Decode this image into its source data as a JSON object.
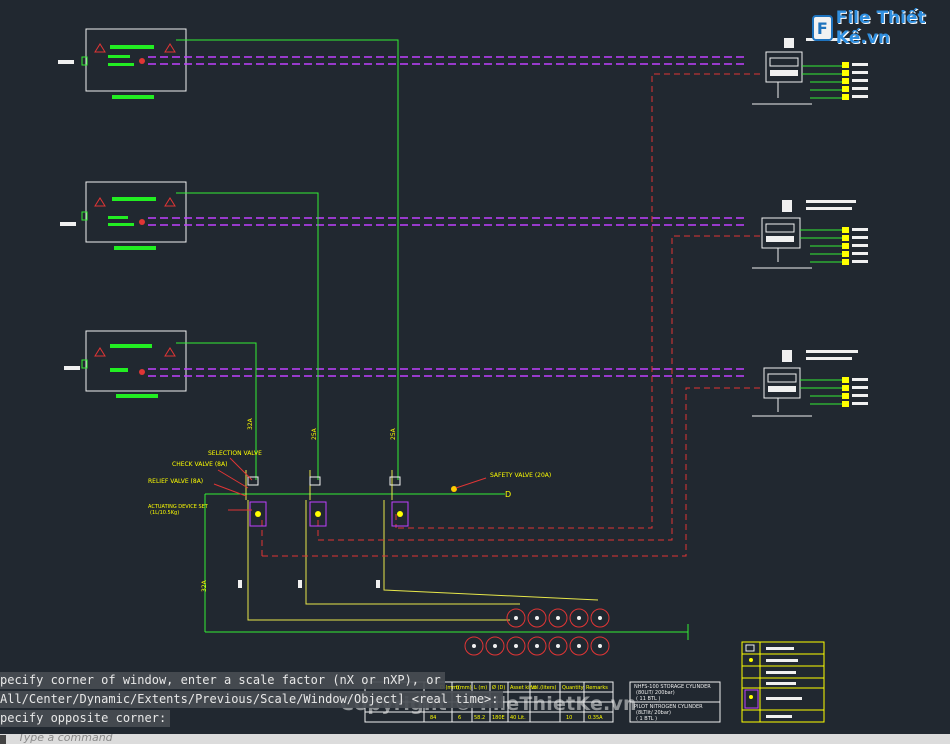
{
  "drawing": {
    "labels": {
      "selection_valve": "SELECTION VALVE",
      "check_valve": "CHECK VALVE (8A)",
      "relief_valve": "RELIEF VALVE (8A)",
      "actuating_device": "ACTUATING DEVICE SET",
      "actuating_device_sub": "(1L/10.5Kg)",
      "safety_valve": "SAFETY VALVE (20A)",
      "pipe_size_1": "32A",
      "pipe_size_2": "25A",
      "pipe_size_3": "25A",
      "pipe_size_4": "32A",
      "outlet_d": "D"
    },
    "schedule": {
      "headers": [
        "D (mm)",
        "t(mm)",
        "L (m)",
        "Ø (D)",
        "Asset kind",
        "Vol.(liters)",
        "Quantity",
        "Remarks"
      ],
      "rows": [
        [
          "",
          "",
          "",
          "",
          "",
          "",
          "",
          ""
        ],
        [
          "84",
          "6",
          "58.2",
          "180E",
          "40 Lit.",
          "10",
          "0.35A"
        ]
      ]
    },
    "legend_notes": {
      "storage_line1": "NHFS-100 STORAGE CYLINDER",
      "storage_line2": "(80LIT/ 200bar)",
      "storage_line3": "( 11 BTL )",
      "pilot_line1": "PILOT NITROGEN CYLINDER",
      "pilot_line2": "(8LTlit/ 20bar)",
      "pilot_line3": "( 1 BTL )"
    },
    "colors": {
      "background": "#212830",
      "pipe_green": "#33ee33",
      "pipe_red_dashed": "#e03535",
      "signal_magenta": "#c040ff",
      "text_yellow": "#ffff00",
      "border_white": "#f0f0f0"
    }
  },
  "watermark": {
    "logo_letter": "F",
    "logo_text": "File Thiết Kế.vn",
    "copyright": "Copyright © FileThietKe.vn"
  },
  "command_line": {
    "history": [
      "pecify corner of window, enter a scale factor (nX or nXP), or",
      "All/Center/Dynamic/Extents/Previous/Scale/Window/Object] <real time>:",
      "pecify opposite corner:"
    ],
    "input_placeholder": "Type a command"
  }
}
